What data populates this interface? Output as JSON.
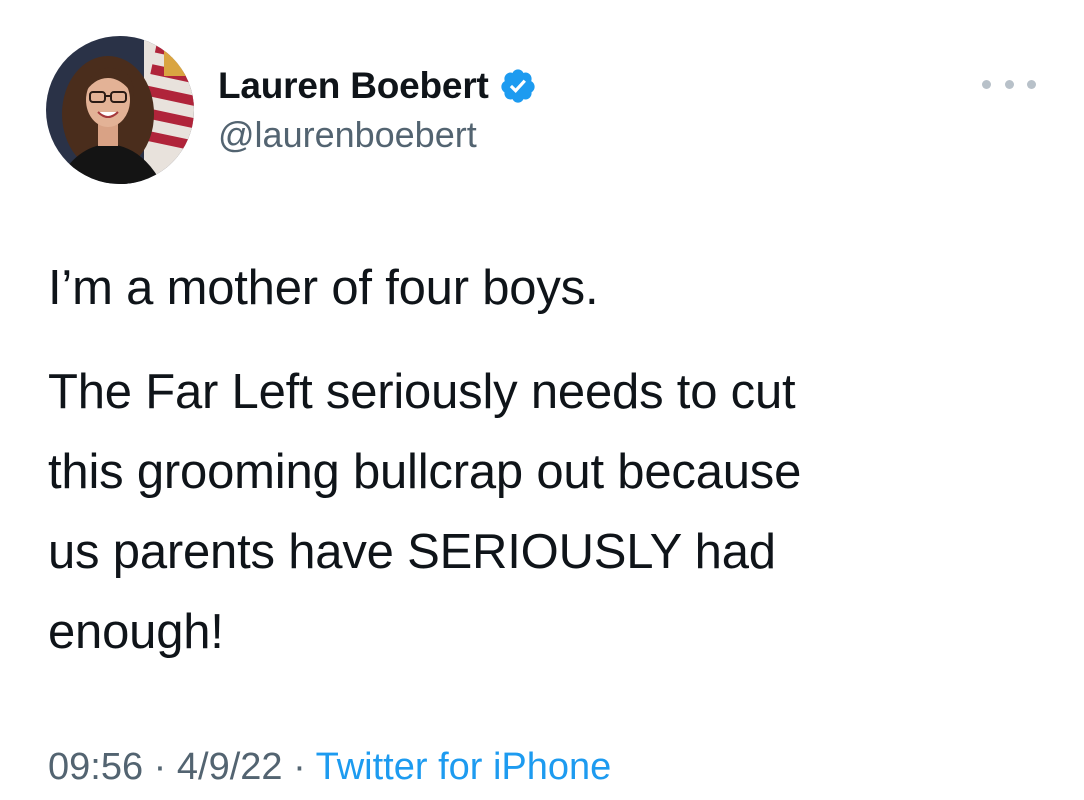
{
  "author": {
    "display_name": "Lauren Boebert",
    "handle": "@laurenboebert",
    "verified": true,
    "avatar_icon": "profile-photo",
    "verified_icon": "verified-badge-icon",
    "verified_color": "#1d9bf0"
  },
  "tweet": {
    "paragraph_1": "I’m a mother of four boys.",
    "paragraph_2_lines": [
      "The Far Left seriously needs to cut",
      "this grooming bullcrap out because",
      "us parents have SERIOUSLY had",
      "enough!"
    ]
  },
  "meta": {
    "time": "09:56",
    "separator": "·",
    "date": "4/9/22",
    "source": "Twitter for iPhone",
    "source_color": "#1d9bf0"
  },
  "more_icon": "more-horizontal-icon"
}
